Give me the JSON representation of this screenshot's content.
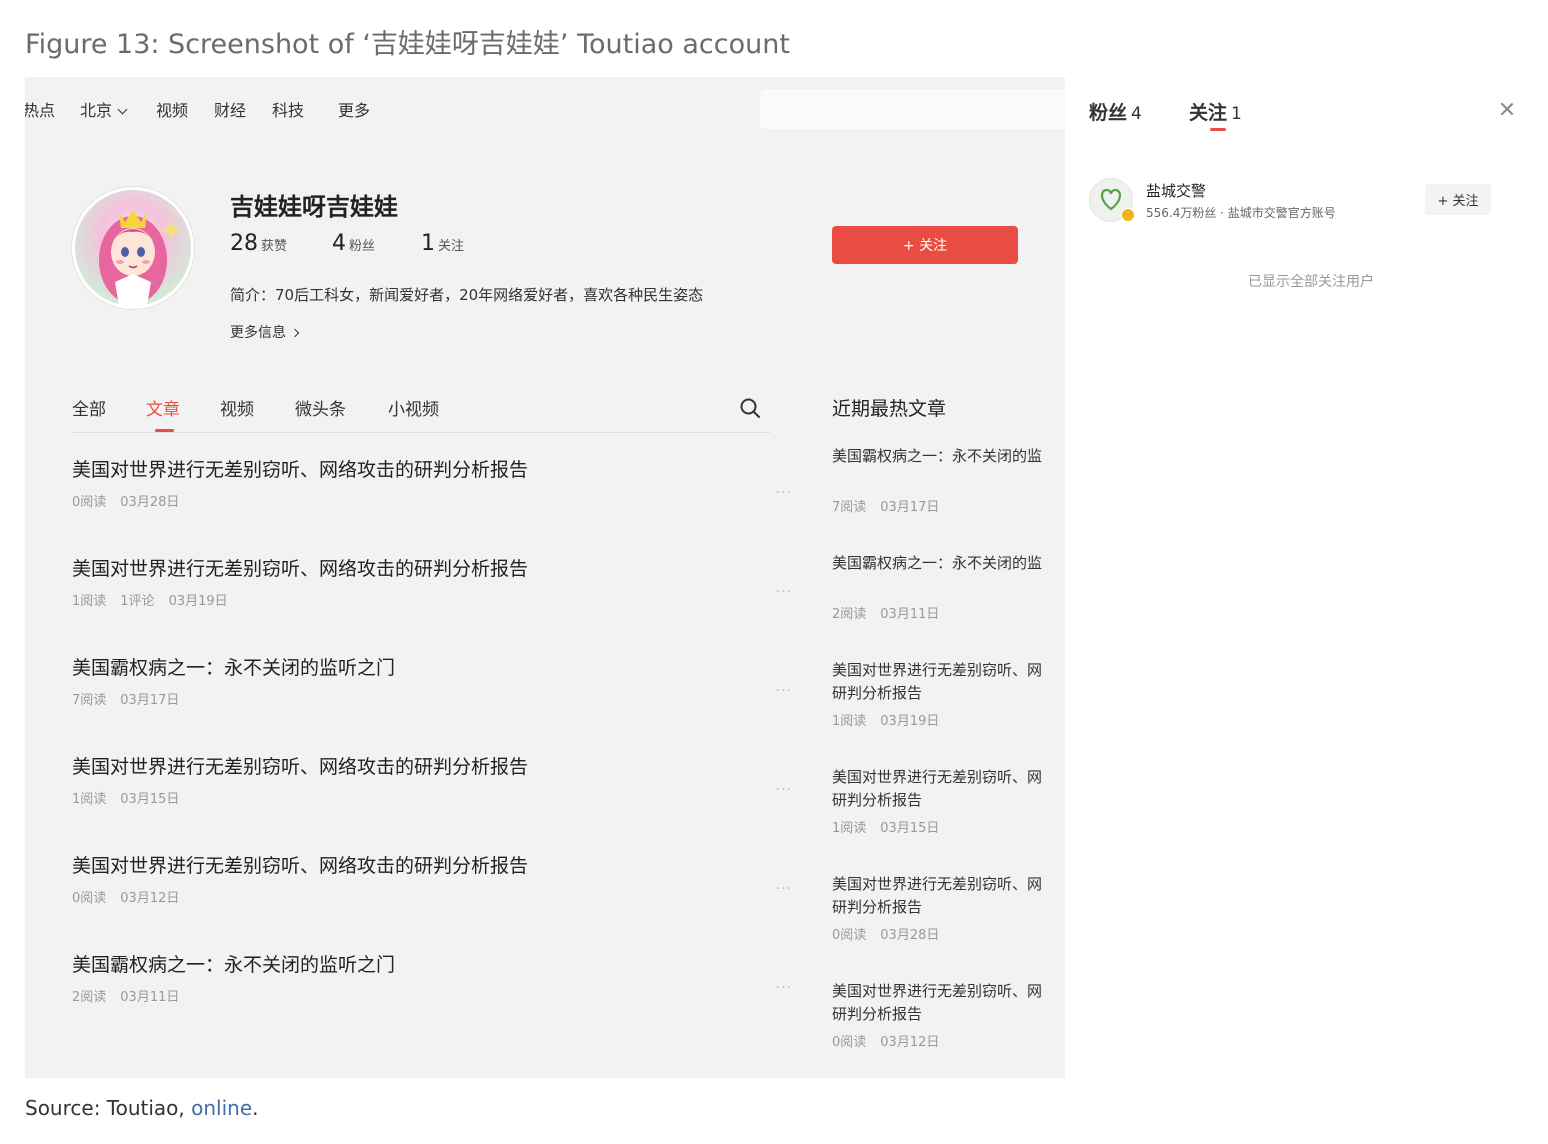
{
  "figure_title": "Figure 13: Screenshot of ‘吉娃娃呀吉娃娃’ Toutiao account",
  "nav": {
    "items": [
      "热点",
      "北京",
      "视频",
      "财经",
      "科技",
      "更多"
    ]
  },
  "profile": {
    "name": "吉娃娃呀吉娃娃",
    "likes_num": "28",
    "likes_label": "获赞",
    "fans_num": "4",
    "fans_label": "粉丝",
    "following_num": "1",
    "following_label": "关注",
    "follow_button": "+ 关注",
    "bio": "简介：70后工科女，新闻爱好者，20年网络爱好者，喜欢各种民生姿态",
    "more_info": "更多信息"
  },
  "tabs": [
    "全部",
    "文章",
    "视频",
    "微头条",
    "小视频"
  ],
  "active_tab": "文章",
  "articles": [
    {
      "title": "美国对世界进行无差别窃听、网络攻击的研判分析报告",
      "reads": "0阅读",
      "comments": "",
      "date": "03月28日"
    },
    {
      "title": "美国对世界进行无差别窃听、网络攻击的研判分析报告",
      "reads": "1阅读",
      "comments": "1评论",
      "date": "03月19日"
    },
    {
      "title": "美国霸权病之一：永不关闭的监听之门",
      "reads": "7阅读",
      "comments": "",
      "date": "03月17日"
    },
    {
      "title": "美国对世界进行无差别窃听、网络攻击的研判分析报告",
      "reads": "1阅读",
      "comments": "",
      "date": "03月15日"
    },
    {
      "title": "美国对世界进行无差别窃听、网络攻击的研判分析报告",
      "reads": "0阅读",
      "comments": "",
      "date": "03月12日"
    },
    {
      "title": "美国霸权病之一：永不关闭的监听之门",
      "reads": "2阅读",
      "comments": "",
      "date": "03月11日"
    }
  ],
  "more_dots": "···",
  "hot": {
    "title": "近期最热文章",
    "items": [
      {
        "line1": "美国霸权病之一：永不关闭的监",
        "line2": "",
        "reads": "7阅读",
        "date": "03月17日"
      },
      {
        "line1": "美国霸权病之一：永不关闭的监",
        "line2": "",
        "reads": "2阅读",
        "date": "03月11日"
      },
      {
        "line1": "美国对世界进行无差别窃听、网",
        "line2": "研判分析报告",
        "reads": "1阅读",
        "date": "03月19日"
      },
      {
        "line1": "美国对世界进行无差别窃听、网",
        "line2": "研判分析报告",
        "reads": "1阅读",
        "date": "03月15日"
      },
      {
        "line1": "美国对世界进行无差别窃听、网",
        "line2": "研判分析报告",
        "reads": "0阅读",
        "date": "03月28日"
      },
      {
        "line1": "美国对世界进行无差别窃听、网",
        "line2": "研判分析报告",
        "reads": "0阅读",
        "date": "03月12日"
      }
    ]
  },
  "panel": {
    "fans_label": "粉丝",
    "fans_num": "4",
    "following_label": "关注",
    "following_num": "1",
    "user_name": "盐城交警",
    "user_desc": "556.4万粉丝 · 盐城市交警官方账号",
    "user_follow": "+ 关注",
    "all_shown": "已显示全部关注用户"
  },
  "source": {
    "prefix": "Source: Toutiao, ",
    "link": "online",
    "suffix": "."
  },
  "colors": {
    "accent": "#e84c42",
    "background": "#f2f2f2",
    "link": "#3d6fa8"
  }
}
